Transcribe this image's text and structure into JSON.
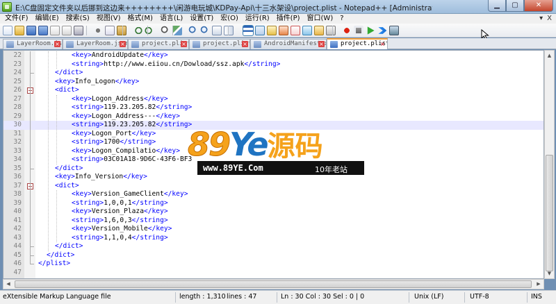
{
  "window": {
    "title": "E:\\C盘固定文件夹以后挪到这边来++++++++\\闲游电玩城\\KDPay-Api\\十三水架设\\project.plist - Notepad++ [Administrator]",
    "minimize_label": "▁",
    "maximize_label": "▢",
    "close_label": "✕"
  },
  "menu": {
    "items": [
      "文件(F)",
      "编辑(E)",
      "搜索(S)",
      "视图(V)",
      "格式(M)",
      "语言(L)",
      "设置(T)",
      "宏(O)",
      "运行(R)",
      "插件(P)",
      "窗口(W)",
      "?"
    ],
    "right_buttons": [
      "▾",
      "X"
    ]
  },
  "toolbar": {
    "icons": [
      "new-file-icon",
      "open-file-icon",
      "save-icon",
      "save-all-icon",
      "close-icon",
      "close-all-icon",
      "print-icon",
      "cut-icon",
      "copy-icon",
      "paste-icon",
      "undo-icon",
      "redo-icon",
      "find-icon",
      "replace-icon",
      "zoom-in-icon",
      "zoom-out-icon",
      "sync-vertical-icon",
      "sync-horizontal-icon",
      "word-wrap-icon",
      "show-all-chars-icon",
      "indent-guide-icon",
      "user-lang-icon",
      "doc-map-icon",
      "function-list-icon",
      "folder-workspace-icon",
      "monitor-icon",
      "record-macro-icon",
      "stop-record-icon",
      "play-macro-icon",
      "run-macro-multiple-icon",
      "save-macro-icon"
    ]
  },
  "tabs": [
    {
      "label": "LayerRoom.json",
      "active": false
    },
    {
      "label": "LayerRoom.json",
      "active": false
    },
    {
      "label": "project.plist",
      "active": false
    },
    {
      "label": "project.plist",
      "active": false
    },
    {
      "label": "AndroidManifest.xml",
      "active": false
    },
    {
      "label": "project.plist",
      "active": true
    }
  ],
  "editor": {
    "current_line": 30,
    "lines": [
      {
        "n": "22",
        "indent": 4,
        "text": "<key>AndroidUpdate</key>"
      },
      {
        "n": "23",
        "indent": 4,
        "text": "<string>http://www.eiiou.cn/Dowload/ssz.apk</string>"
      },
      {
        "n": "24",
        "indent": 2,
        "text": "</dict>"
      },
      {
        "n": "25",
        "indent": 2,
        "text": "<key>Info_Logon</key>"
      },
      {
        "n": "26",
        "indent": 2,
        "text": "<dict>"
      },
      {
        "n": "27",
        "indent": 4,
        "text": "<key>Logon_Address</key>"
      },
      {
        "n": "28",
        "indent": 4,
        "text": "<string>119.23.205.82</string>"
      },
      {
        "n": "29",
        "indent": 4,
        "text": "<key>Logon_Address---</key>"
      },
      {
        "n": "30",
        "indent": 4,
        "text": "<string>119.23.205.82</string>"
      },
      {
        "n": "31",
        "indent": 4,
        "text": "<key>Logon_Port</key>"
      },
      {
        "n": "32",
        "indent": 4,
        "text": "<string>1700</string>"
      },
      {
        "n": "33",
        "indent": 4,
        "text": "<key>Logon_Compilatio</key>"
      },
      {
        "n": "34",
        "indent": 4,
        "text": "<string>03C01A18-9D6C-43F6-BF3"
      },
      {
        "n": "35",
        "indent": 2,
        "text": "</dict>"
      },
      {
        "n": "36",
        "indent": 2,
        "text": "<key>Info_Version</key>"
      },
      {
        "n": "37",
        "indent": 2,
        "text": "<dict>"
      },
      {
        "n": "38",
        "indent": 4,
        "text": "<key>Version_GameClient</key>"
      },
      {
        "n": "39",
        "indent": 4,
        "text": "<string>1,0,0,1</string>"
      },
      {
        "n": "40",
        "indent": 4,
        "text": "<key>Version_Plaza</key>"
      },
      {
        "n": "41",
        "indent": 4,
        "text": "<string>1,6,0,3</string>"
      },
      {
        "n": "42",
        "indent": 4,
        "text": "<key>Version_Mobile</key>"
      },
      {
        "n": "43",
        "indent": 4,
        "text": "<string>1,1,0,4</string>"
      },
      {
        "n": "44",
        "indent": 2,
        "text": "</dict>"
      },
      {
        "n": "45",
        "indent": 1,
        "text": "</dict>"
      },
      {
        "n": "46",
        "indent": 0,
        "text": "</plist>"
      },
      {
        "n": "47",
        "indent": 0,
        "text": ""
      }
    ]
  },
  "watermark": {
    "brand_digits": "89",
    "brand_letters": "Ye",
    "brand_chinese": "源码",
    "url": "www.89YE.Com",
    "tagline": "10年老站"
  },
  "statusbar": {
    "language": "eXtensible Markup Language file",
    "length": "length : 1,310",
    "lines": "lines : 47",
    "position": "Ln : 30    Col : 30    Sel : 0 | 0",
    "eol": "Unix (LF)",
    "encoding": "UTF-8",
    "mode": "INS"
  },
  "colors": {
    "tag": "#0000ff",
    "text": "#000000",
    "current_line_bg": "#e8e8ff",
    "active_tab_accent": "#f7a23b",
    "watermark_orange": "#f5a21b",
    "watermark_blue": "#1f74c2"
  }
}
